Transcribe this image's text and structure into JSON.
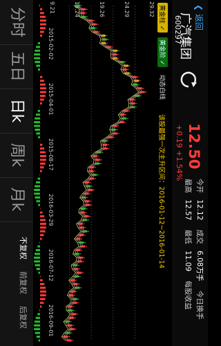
{
  "header": {
    "back": "返回",
    "title": "广汽集团",
    "code": "600297",
    "price": "12.50",
    "change": "+0.19  +1.54%",
    "stats": [
      {
        "label": "今开",
        "value": "12.12",
        "label2": "成交",
        "value2": "6.08万手",
        "label3": "今日换手",
        "value3": ""
      },
      {
        "label": "最高",
        "value": "12.57",
        "label2": "最低",
        "value2": "11.09",
        "label3": "每股收益",
        "value3": ""
      }
    ]
  },
  "legend": {
    "tag1": "黄金柱",
    "tag2": "黄金阶",
    "dynamic": "动态白线",
    "note": "该股最强一次主升区间：2016-01-12~2016-01-14"
  },
  "axis": {
    "price_ticks": [
      "29.32",
      "24.29",
      "19.26",
      "14.24",
      "9.21"
    ],
    "vol_ticks": [
      "100.00",
      "50.00",
      "0.00",
      "-100.00"
    ],
    "dates": [
      "2015-02-02",
      "2015-04-01",
      "2015-08-17",
      "2016-03-29",
      "2016-07-12",
      "2016-09-01"
    ]
  },
  "tabs": {
    "items": [
      "分时",
      "五日",
      "日k",
      "周k",
      "月k"
    ],
    "selected": "日k",
    "adjust": [
      "不复权",
      "前复权",
      "后复权"
    ],
    "adjust_selected": "不复权"
  },
  "colors": {
    "up": "#ff3b3b",
    "down": "#22c12a",
    "gold": "#e8c100"
  }
}
